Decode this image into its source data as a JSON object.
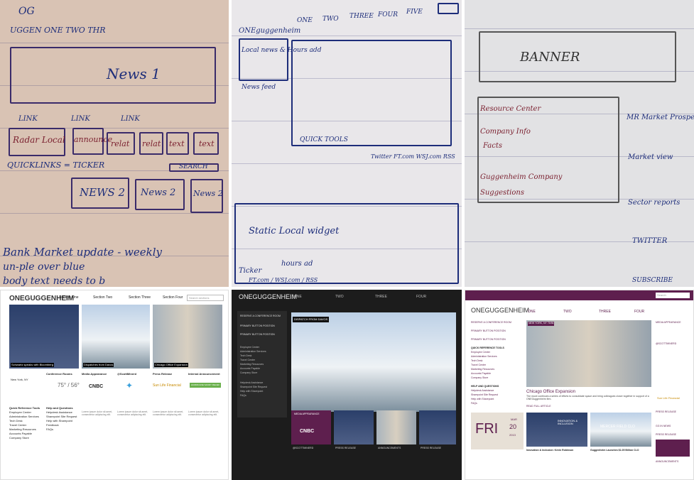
{
  "sketch1": {
    "header": "UGGEN  ONE   TWO   THR",
    "nav_corner": "OG",
    "news1": "News 1",
    "links": [
      "LINK",
      "LINK",
      "LINK"
    ],
    "row": [
      "Radar Local",
      "announce",
      "relat",
      "relat",
      "text",
      "text"
    ],
    "quicklinks": "QUICKLINKS = TICKER",
    "search": "SEARCH",
    "news2": [
      "NEWS 2",
      "News 2",
      "News 2"
    ],
    "notes": [
      "Bank Market update - weekly",
      "un-ple over blue",
      "body text needs to b"
    ]
  },
  "sketch2": {
    "logo": "ONEguggenheim",
    "tabs": [
      "ONE",
      "TWO",
      "THREE",
      "FOUR",
      "FIVE"
    ],
    "side": [
      "Local news & Hours add",
      "News feed"
    ],
    "quick": "QUICK TOOLS",
    "footer": "Twitter  FT.com  WSJ.com  RSS",
    "bottom": [
      "Static Local widget",
      "Ticker",
      "hours ad",
      "FT.com / WSJ.com / RSS"
    ]
  },
  "sketch3": {
    "banner": "BANNER",
    "left": [
      "Resource Center",
      "Company Info",
      "Facts",
      "Guggenheim Company",
      "Suggestions"
    ],
    "right": [
      "MR Market Prospect",
      "Market view",
      "Sector reports",
      "TWITTER",
      "SUBSCRIBE"
    ]
  },
  "mock1": {
    "logo": "ONEGUGGENHEIM",
    "tabs": [
      "Section One",
      "Section Two",
      "Section Three",
      "Section Four"
    ],
    "search": "Search sections",
    "captions": [
      "Schwartz speaks with Bloomberg",
      "Dispatches from Davos",
      "Chicago Office Expansion"
    ],
    "heads": [
      "Conference Rooms",
      "Media Appearance",
      "@ScottMinerd",
      "Press Release",
      "Internal Announcement"
    ],
    "weather": "75° / 56°",
    "city": "New York, NY",
    "quick": [
      "Quick Reference Tools",
      "Employee Center",
      "Administration Services",
      "Tech Desk",
      "Travel Center",
      "Marketing Resources",
      "Accounts Payable",
      "Company Store"
    ],
    "help": [
      "Help and Questions",
      "Helpdesk Assistance",
      "Sharepoint Site Request",
      "Help with Sharepoint",
      "Feedback",
      "FAQs"
    ],
    "logos": [
      "CNBC",
      "Sun Life Financial",
      "HURRICANE SANDY RELIEF"
    ],
    "body": "Lorem ipsum dolor sit amet, consectetur adipiscing elit."
  },
  "mock2": {
    "logo": "ONEGUGGENHEIM",
    "tabs": [
      "ONE",
      "TWO",
      "THREE",
      "FOUR"
    ],
    "banner": "DISPATCH FROM DAVOS",
    "menu": [
      "RESERVE A CONFERENCE ROOM",
      "PRIMARY BUTTON POSITION",
      "PRIMARY BUTTON POSITION",
      "Employee Center",
      "Administration Services",
      "Tech Desk",
      "Travel Center",
      "Marketing Resources",
      "Accounts Payable",
      "Company Store",
      "Helpdesk Assistance",
      "Sharepoint Site Request",
      "Help with Sharepoint",
      "FAQs"
    ],
    "media": "MEDIA APPEARANCE",
    "heads": [
      "@SCOTTMINERD",
      "PRESS RELEASE",
      "ANNOUNCEMENTS",
      "PRESS RELEASE"
    ],
    "logo_cnbc": "CNBC"
  },
  "mock3": {
    "logo": "ONEGUGGENHEIM",
    "tabs": [
      "ONE",
      "TWO",
      "THREE",
      "FOUR"
    ],
    "search": "Search",
    "menu": [
      "RESERVE A CONFERENCE ROOM",
      "PRIMARY BUTTON POSITION",
      "PRIMARY BUTTON POSITION",
      "QUICK REFERENCE TOOLS",
      "Employee Center",
      "Administration Services",
      "Tech Desk",
      "Travel Center",
      "Marketing Resources",
      "Accounts Payable",
      "Company Store",
      "HELP AND QUESTIONS",
      "Helpdesk Assistance",
      "Sharepoint Site Request",
      "Help with Sharepoint",
      "FAQs"
    ],
    "weather": "NEW YORK, NY  75/56",
    "headline": "Chicago Office Expansion",
    "lead": "The move continues a series of efforts to consolidate space and bring colleagues closer together in support of a ONEGuggenheim firm.",
    "read": "READ FULL ARTICLE",
    "date_day": "FRI",
    "date_month": "MAR",
    "date_num": "20",
    "date_year": "2013",
    "innovation": "INNOVATION & INCLUSION",
    "mercer": "MERCER FIELD CLO",
    "story1": "Innovation & Inclusion: Kevin Robinson",
    "story2": "Guggenheim Launches $1.05 Billion CLO",
    "side": [
      "MEDIA APPEARANCE",
      "@SCOTTMINERD",
      "PRESS RELEASE",
      "GG IN NEWS",
      "PRESS RELEASE",
      "ANNOUNCEMENTS"
    ],
    "logo_sun": "Sun Life Financial"
  }
}
